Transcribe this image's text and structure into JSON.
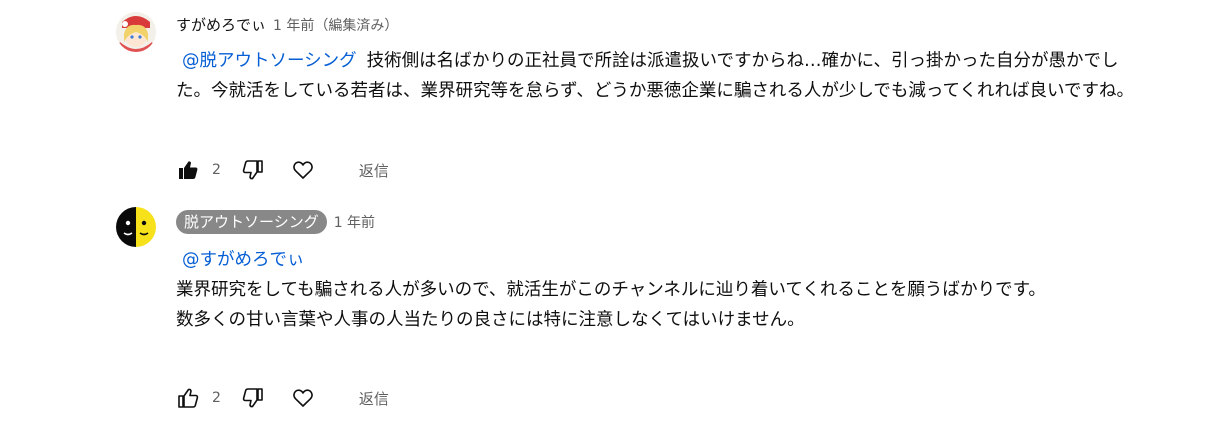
{
  "comments": [
    {
      "author": "すがめろでぃ",
      "time": "1 年前（編集済み）",
      "mention": "@脱アウトソーシング",
      "text": "技術側は名ばかりの正社員で所詮は派遣扱いですからね…確かに、引っ掛かった自分が愚かでした。今就活をしている若者は、業界研究等を怠らず、どうか悪徳企業に騙される人が少しでも減ってくれれば良いですね。",
      "likes": "2",
      "like_icon": "thumbs-up-filled",
      "reply_label": "返信"
    },
    {
      "author": "脱アウトソーシング",
      "time": "1 年前",
      "mention": "@すがめろでぃ",
      "text_line1": "業界研究をしても騙される人が多いので、就活生がこのチャンネルに辿り着いてくれることを願うばかりです。",
      "text_line2": "数多くの甘い言葉や人事の人当たりの良さには特に注意しなくてはいけません。",
      "likes": "2",
      "like_icon": "thumbs-up-outline",
      "reply_label": "返信"
    }
  ]
}
